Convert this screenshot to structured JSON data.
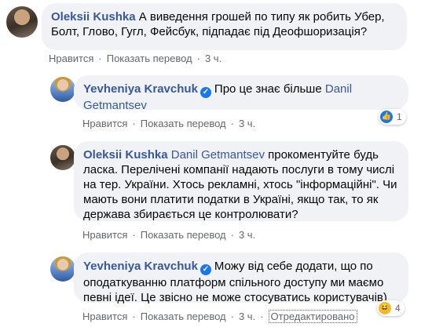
{
  "comments": [
    {
      "author": "Oleksii Kushka",
      "text": "А виведення грошей по типу як робить Убер, Болт, Глово, Гугл, Фейсбук, підпадає під Деофшоризація?",
      "actions": {
        "like": "Нравится",
        "translate": "Показать перевод",
        "time": "3 ч."
      }
    },
    {
      "author": "Yevheniya Kravchuk",
      "text": "Про це знає більше ",
      "mention": "Danil Getmantsev",
      "actions": {
        "like": "Нравится",
        "translate": "Показать перевод",
        "time": "3 ч."
      },
      "reaction": {
        "icon": "like-icon",
        "count": "1"
      }
    },
    {
      "author": "Oleksii Kushka",
      "mention": "Danil Getmantsev",
      "text": " прокоментуйте будь ласка. Перелічені компанії надають послуги в тому числі на тер. України. Хтось рекламні, хтось \"інформаційні\". Чи мають вони платити податки в Україні, якщо так, то як держава збирається це контролювати?",
      "actions": {
        "like": "Нравится",
        "translate": "Показать перевод",
        "time": "3 ч."
      }
    },
    {
      "author": "Yevheniya Kravchuk",
      "text": "Можу від себе додати, що по оподаткуванню платформ спільного доступу ми маємо певні ідеї. Це звісно не може стосуватись користувачів)",
      "actions": {
        "like": "Нравится",
        "translate": "Показать перевод",
        "time": "3 ч.",
        "edited": "Отредактировано"
      },
      "reaction": {
        "icon": "haha-icon",
        "count": "4"
      }
    }
  ],
  "sep": "·",
  "colors": {
    "link": "#385898",
    "bubble": "#f0f2f5",
    "meta": "#65676b",
    "like": "#1877f2",
    "haha": "#f7b928"
  }
}
